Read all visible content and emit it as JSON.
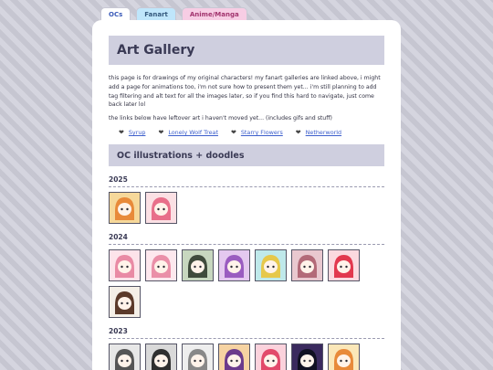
{
  "tabs": [
    {
      "label": "OCs"
    },
    {
      "label": "Fanart"
    },
    {
      "label": "Anime/Manga"
    }
  ],
  "page": {
    "title": "Art Gallery",
    "intro": "this page is for drawings of my original characters! my fanart galleries are linked above, i might add a page for animations too, i'm not sure how to present them yet... i'm still planning to add tag filtering and alt text for all the images later, so if you find this hard to navigate, just come back later lol",
    "links_note": "the links below have leftover art i haven't moved yet... (includes gifs and stuff)"
  },
  "links": [
    {
      "label": "Syrup"
    },
    {
      "label": "Lonely Wolf Treat"
    },
    {
      "label": "Starry Flowers"
    },
    {
      "label": "Netherworld"
    }
  ],
  "section": {
    "title": "OC illustrations + doodles"
  },
  "years": [
    {
      "label": "2025",
      "thumbs": [
        {
          "bg": "#f6d89a",
          "fg": "#e88a3a"
        },
        {
          "bg": "#fbe0e4",
          "fg": "#e86f8a"
        }
      ]
    },
    {
      "label": "2024",
      "thumbs": [
        {
          "bg": "#fde3ea",
          "fg": "#e98aa5"
        },
        {
          "bg": "#fde8ee",
          "fg": "#ea8fa8"
        },
        {
          "bg": "#c7d7bf",
          "fg": "#3f4b3c"
        },
        {
          "bg": "#e4c8ef",
          "fg": "#9a5cc0"
        },
        {
          "bg": "#bfe9ea",
          "fg": "#e6c84a"
        },
        {
          "bg": "#e9c8cf",
          "fg": "#b36a78"
        },
        {
          "bg": "#fbd9df",
          "fg": "#e2384e"
        },
        {
          "bg": "#f4efe7",
          "fg": "#5b3a2a"
        }
      ]
    },
    {
      "label": "2023",
      "thumbs": [
        {
          "bg": "#e7e7e7",
          "fg": "#555555"
        },
        {
          "bg": "#d9d9d9",
          "fg": "#2f2f2f"
        },
        {
          "bg": "#eeeeee",
          "fg": "#888888"
        },
        {
          "bg": "#f6d3a2",
          "fg": "#6b3b8c"
        },
        {
          "bg": "#fbd2dc",
          "fg": "#e24a6a"
        },
        {
          "bg": "#3a2a5e",
          "fg": "#111122"
        },
        {
          "bg": "#fbe7b8",
          "fg": "#e88a3a"
        }
      ]
    }
  ]
}
